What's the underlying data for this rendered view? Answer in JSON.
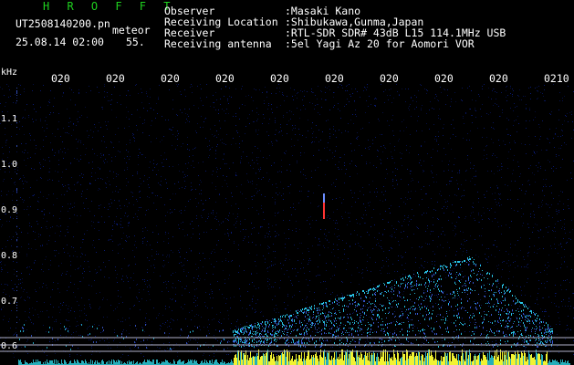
{
  "header": {
    "app_name": "H R O F F T",
    "filename": "UT2508140200.pn",
    "mode": "meteor",
    "datetime": "25.08.14 02:00",
    "count": "55.",
    "info_labels": [
      "Observer",
      "Receiving Location",
      "Receiver",
      "Receiving antenna"
    ],
    "info_values": [
      ":Masaki Kano",
      ":Shibukawa,Gunma,Japan",
      ":RTL-SDR SDR# 43dB L15 114.1MHz USB",
      ":5el Yagi Az 20 for Aomori VOR"
    ]
  },
  "axis": {
    "y_unit": "kHz",
    "y_ticks": [
      "1.1",
      "1.0",
      "0.9",
      "0.8",
      "0.7",
      "0.6"
    ],
    "x_ticks": [
      "020",
      "020",
      "020",
      "020",
      "020",
      "020",
      "020",
      "020",
      "020",
      "0210"
    ]
  },
  "colors": {
    "background": "#000000",
    "text": "#ffffff",
    "title": "#1fd11f",
    "noise": "#0b1f8a",
    "signal": "#29c6e8",
    "strong_signal": "#ffff33",
    "meteor": "#ff3333"
  }
}
